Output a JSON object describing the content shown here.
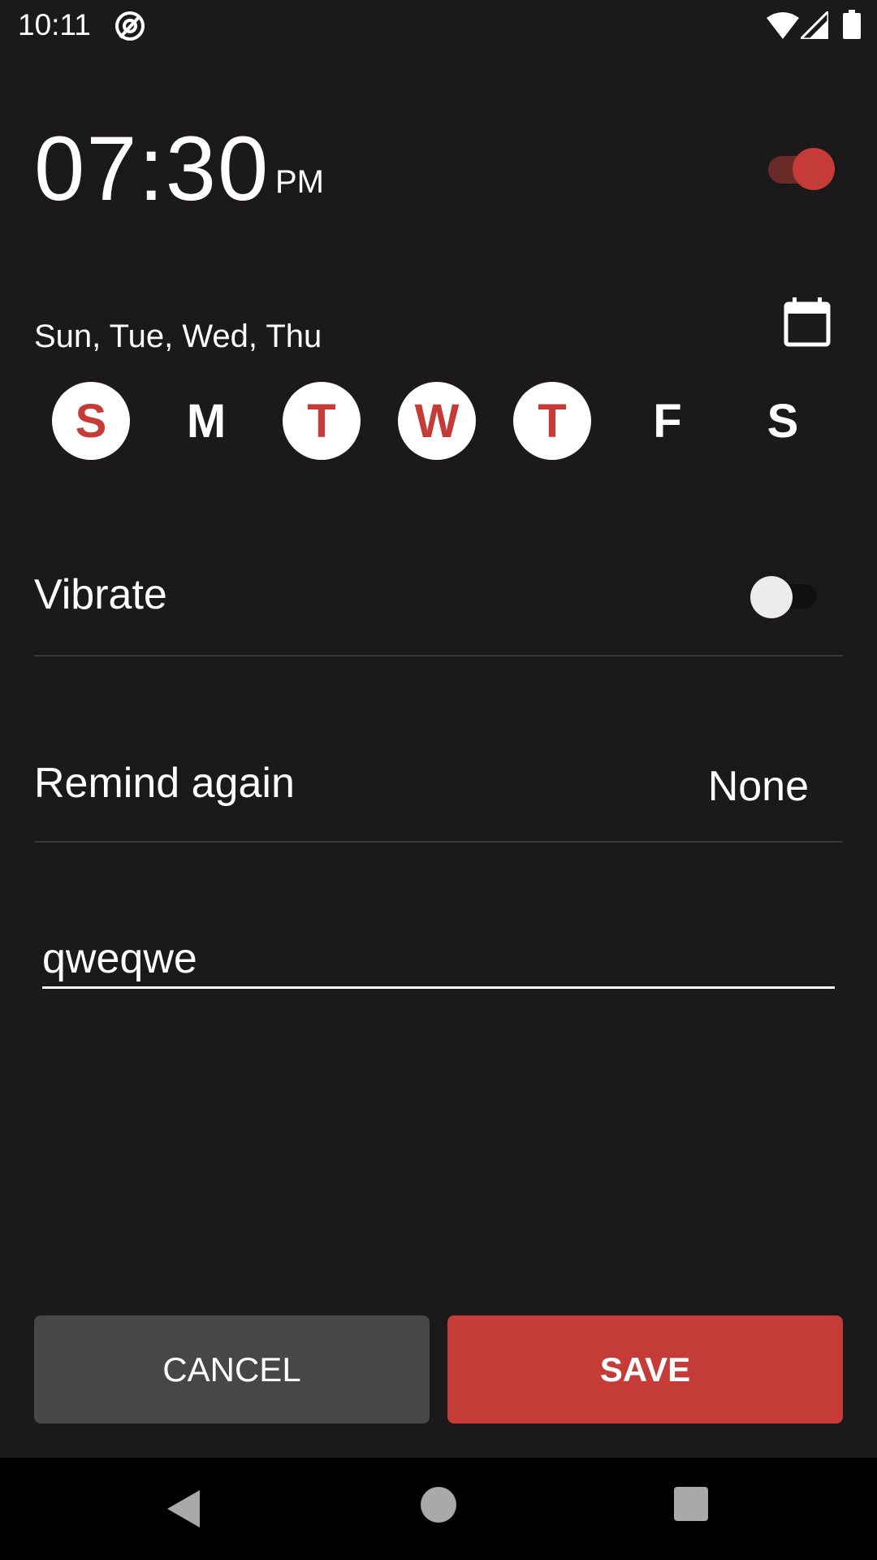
{
  "status_bar": {
    "time": "10:11",
    "icons": [
      "at-sign-icon",
      "wifi-icon",
      "signal-icon",
      "battery-icon"
    ]
  },
  "alarm": {
    "time": "07:30",
    "ampm": "PM",
    "enabled": true
  },
  "days": {
    "summary": "Sun, Tue, Wed, Thu",
    "items": [
      {
        "letter": "S",
        "selected": true
      },
      {
        "letter": "M",
        "selected": false
      },
      {
        "letter": "T",
        "selected": true
      },
      {
        "letter": "W",
        "selected": true
      },
      {
        "letter": "T",
        "selected": true
      },
      {
        "letter": "F",
        "selected": false
      },
      {
        "letter": "S",
        "selected": false
      }
    ]
  },
  "vibrate": {
    "label": "Vibrate",
    "enabled": false
  },
  "remind": {
    "label": "Remind again",
    "value": "None"
  },
  "label_input": {
    "value": "qweqwe"
  },
  "buttons": {
    "cancel": "CANCEL",
    "save": "SAVE"
  },
  "colors": {
    "accent": "#c53b37",
    "background": "#1b191a"
  }
}
